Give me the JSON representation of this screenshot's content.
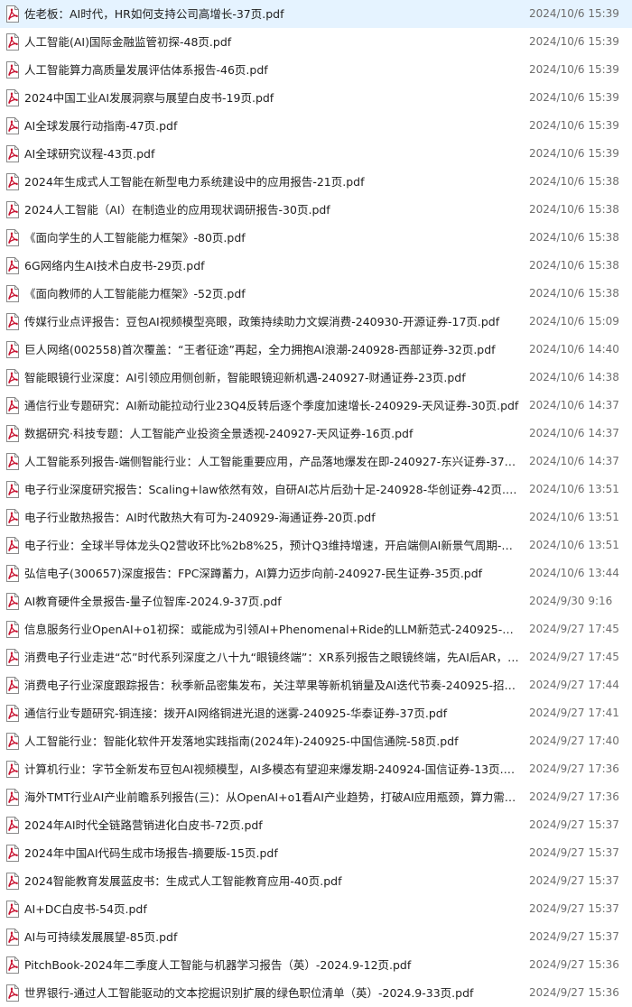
{
  "files": [
    {
      "name": "佐老板：AI时代，HR如何支持公司高增长-37页.pdf",
      "date": "2024/10/6 15:39",
      "icon": "pdf-file-icon"
    },
    {
      "name": "人工智能(AI)国际金融监管初探-48页.pdf",
      "date": "2024/10/6 15:39",
      "icon": "pdf-file-icon"
    },
    {
      "name": "人工智能算力高质量发展评估体系报告-46页.pdf",
      "date": "2024/10/6 15:39",
      "icon": "pdf-file-icon"
    },
    {
      "name": "2024中国工业AI发展洞察与展望白皮书-19页.pdf",
      "date": "2024/10/6 15:39",
      "icon": "pdf-file-icon"
    },
    {
      "name": "AI全球发展行动指南-47页.pdf",
      "date": "2024/10/6 15:39",
      "icon": "pdf-file-icon"
    },
    {
      "name": "AI全球研究议程-43页.pdf",
      "date": "2024/10/6 15:39",
      "icon": "pdf-file-icon"
    },
    {
      "name": "2024年生成式人工智能在新型电力系统建设中的应用报告-21页.pdf",
      "date": "2024/10/6 15:38",
      "icon": "pdf-file-icon"
    },
    {
      "name": "2024人工智能（AI）在制造业的应用现状调研报告-30页.pdf",
      "date": "2024/10/6 15:38",
      "icon": "pdf-file-icon"
    },
    {
      "name": "《面向学生的人工智能能力框架》-80页.pdf",
      "date": "2024/10/6 15:38",
      "icon": "pdf-file-icon"
    },
    {
      "name": "6G网络内生AI技术白皮书-29页.pdf",
      "date": "2024/10/6 15:38",
      "icon": "pdf-file-icon"
    },
    {
      "name": "《面向教师的人工智能能力框架》-52页.pdf",
      "date": "2024/10/6 15:38",
      "icon": "pdf-file-icon"
    },
    {
      "name": "传媒行业点评报告：豆包AI视频模型亮眼，政策持续助力文娱消费-240930-开源证券-17页.pdf",
      "date": "2024/10/6 15:09",
      "icon": "pdf-file-icon"
    },
    {
      "name": "巨人网络(002558)首次覆盖：“王者征途”再起，全力拥抱AI浪潮-240928-西部证券-32页.pdf",
      "date": "2024/10/6 14:40",
      "icon": "pdf-file-icon"
    },
    {
      "name": "智能眼镜行业深度：AI引领应用侧创新，智能眼镜迎新机遇-240927-财通证券-23页.pdf",
      "date": "2024/10/6 14:38",
      "icon": "pdf-file-icon"
    },
    {
      "name": "通信行业专题研究：AI新动能拉动行业23Q4反转后逐个季度加速增长-240929-天风证券-30页.pdf",
      "date": "2024/10/6 14:37",
      "icon": "pdf-file-icon"
    },
    {
      "name": "数据研究·科技专题：人工智能产业投资全景透视-240927-天风证券-16页.pdf",
      "date": "2024/10/6 14:37",
      "icon": "pdf-file-icon"
    },
    {
      "name": "人工智能系列报告-端侧智能行业：人工智能重要应用，产品落地爆发在即-240927-东兴证券-37页.pdf",
      "date": "2024/10/6 14:37",
      "icon": "pdf-file-icon"
    },
    {
      "name": "电子行业深度研究报告：Scaling+law依然有效，自研AI芯片后劲十足-240928-华创证券-42页.pdf",
      "date": "2024/10/6 13:51",
      "icon": "pdf-file-icon"
    },
    {
      "name": "电子行业散热报告：AI时代散热大有可为-240929-海通证券-20页.pdf",
      "date": "2024/10/6 13:51",
      "icon": "pdf-file-icon"
    },
    {
      "name": "电子行业：全球半导体龙头Q2营收环比%2b8%25，预计Q3维持增速，开启端侧AI新景气周期-240929-…",
      "date": "2024/10/6 13:51",
      "icon": "pdf-file-icon"
    },
    {
      "name": "弘信电子(300657)深度报告：FPC深蹲蓄力，AI算力迈步向前-240927-民生证券-35页.pdf",
      "date": "2024/10/6 13:44",
      "icon": "pdf-file-icon"
    },
    {
      "name": "AI教育硬件全景报告-量子位智库-2024.9-37页.pdf",
      "date": "2024/9/30 9:16",
      "icon": "pdf-file-icon"
    },
    {
      "name": "信息服务行业OpenAI+o1初探：或能成为引领AI+Phenomenal+Ride的LLM新范式-240925-海通证…",
      "date": "2024/9/27 17:45",
      "icon": "pdf-file-icon"
    },
    {
      "name": "消费电子行业走进“芯”时代系列深度之八十九“眼镜终端”：XR系列报告之眼镜终端，先AI后AR，眼镜…",
      "date": "2024/9/27 17:45",
      "icon": "pdf-file-icon"
    },
    {
      "name": "消费电子行业深度跟踪报告：秋季新品密集发布，关注苹果等新机销量及AI迭代节奏-240925-招商证…",
      "date": "2024/9/27 17:44",
      "icon": "pdf-file-icon"
    },
    {
      "name": "通信行业专题研究-铜连接：拨开AI网络铜进光退的迷雾-240925-华泰证券-37页.pdf",
      "date": "2024/9/27 17:41",
      "icon": "pdf-file-icon"
    },
    {
      "name": "人工智能行业：智能化软件开发落地实践指南(2024年)-240925-中国信通院-58页.pdf",
      "date": "2024/9/27 17:40",
      "icon": "pdf-file-icon"
    },
    {
      "name": "计算机行业：字节全新发布豆包AI视频模型，AI多模态有望迎来爆发期-240924-国信证券-13页.pdf",
      "date": "2024/9/27 17:36",
      "icon": "pdf-file-icon"
    },
    {
      "name": "海外TMT行业AI产业前瞻系列报告(三)：从OpenAI+o1看AI产业趋势，打破AI应用瓶颈，算力需求前…",
      "date": "2024/9/27 17:36",
      "icon": "pdf-file-icon"
    },
    {
      "name": "2024年AI时代全链路营销进化白皮书-72页.pdf",
      "date": "2024/9/27 15:37",
      "icon": "pdf-file-icon"
    },
    {
      "name": "2024年中国AI代码生成市场报告-摘要版-15页.pdf",
      "date": "2024/9/27 15:37",
      "icon": "pdf-file-icon"
    },
    {
      "name": "2024智能教育发展蓝皮书：生成式人工智能教育应用-40页.pdf",
      "date": "2024/9/27 15:37",
      "icon": "pdf-file-icon"
    },
    {
      "name": "AI+DC白皮书-54页.pdf",
      "date": "2024/9/27 15:37",
      "icon": "pdf-file-icon"
    },
    {
      "name": "AI与可持续发展展望-85页.pdf",
      "date": "2024/9/27 15:37",
      "icon": "pdf-file-icon"
    },
    {
      "name": "PitchBook-2024年二季度人工智能与机器学习报告（英）-2024.9-12页.pdf",
      "date": "2024/9/27 15:36",
      "icon": "pdf-file-icon"
    },
    {
      "name": "世界银行-通过人工智能驱动的文本挖掘识别扩展的绿色职位清单（英）-2024.9-33页.pdf",
      "date": "2024/9/27 15:36",
      "icon": "pdf-file-icon"
    }
  ],
  "colors": {
    "pdf_red": "#c8102e",
    "date_gray": "#6d6d6d",
    "text": "#1e1e1e"
  }
}
